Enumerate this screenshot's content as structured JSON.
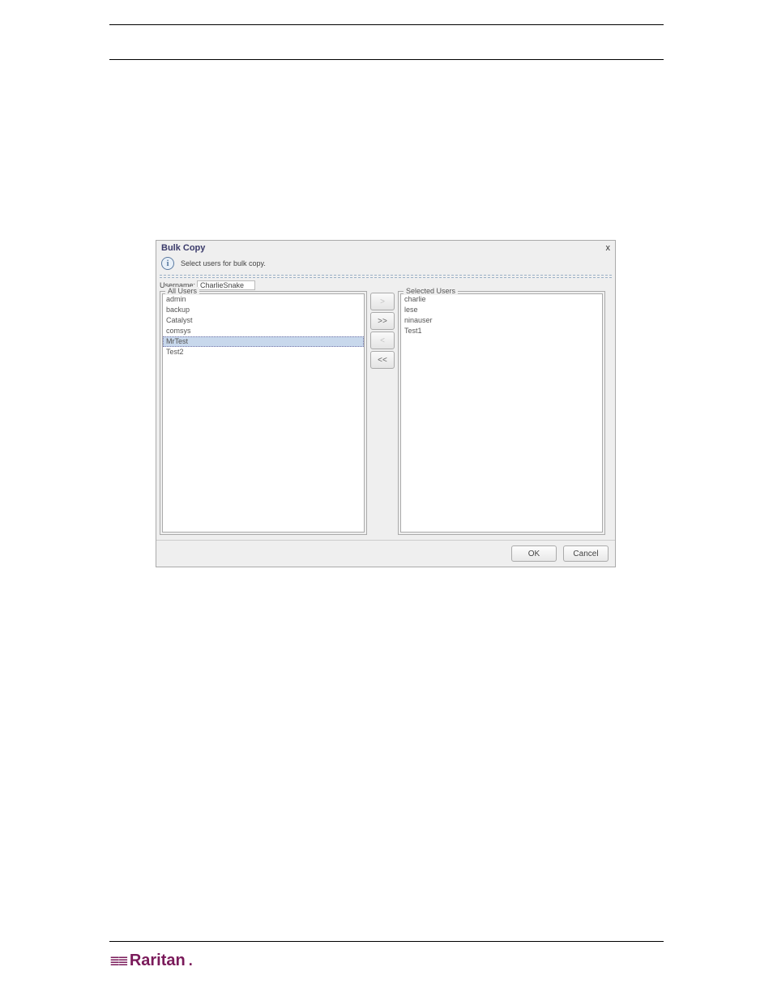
{
  "header": {
    "top_rule": true,
    "second_rule": true
  },
  "dialog": {
    "title": "Bulk Copy",
    "close_glyph": "x",
    "info_text": "Select users for bulk copy.",
    "username_label": "Username:",
    "username_value": "CharlieSnake",
    "all_users_legend": "All Users",
    "selected_users_legend": "Selected Users",
    "all_users": [
      {
        "label": "admin",
        "selected": false
      },
      {
        "label": "backup",
        "selected": false
      },
      {
        "label": "Catalyst",
        "selected": false
      },
      {
        "label": "comsys",
        "selected": false
      },
      {
        "label": "MrTest",
        "selected": true
      },
      {
        "label": "Test2",
        "selected": false
      }
    ],
    "selected_users": [
      {
        "label": "charlie"
      },
      {
        "label": "lese"
      },
      {
        "label": "ninauser"
      },
      {
        "label": "Test1"
      }
    ],
    "mover": {
      "add": ">",
      "add_all": ">>",
      "remove": "<",
      "remove_all": "<<",
      "add_disabled": true,
      "remove_disabled": true
    },
    "buttons": {
      "ok": "OK",
      "cancel": "Cancel"
    }
  },
  "footer": {
    "brand": "Raritan"
  }
}
